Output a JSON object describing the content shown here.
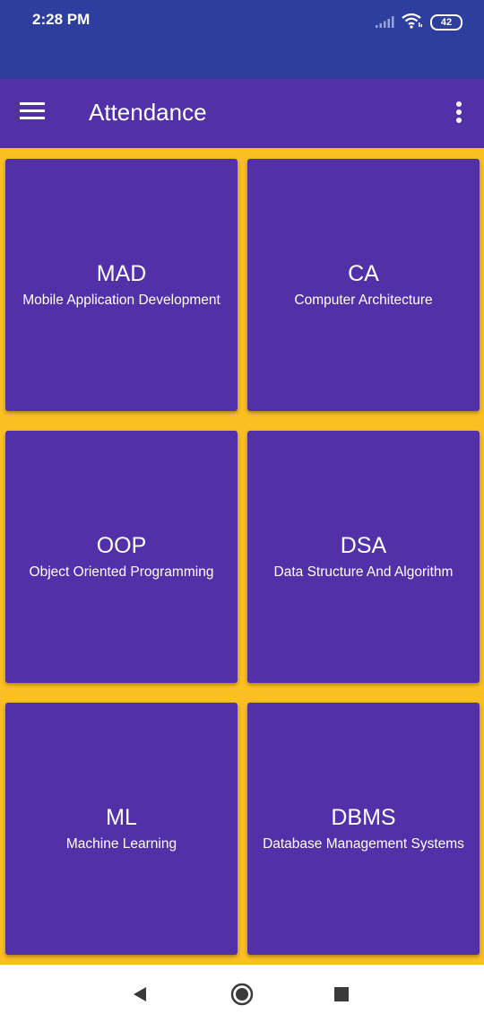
{
  "status_bar": {
    "time": "2:28 PM",
    "battery": "42",
    "icons": [
      "signal-icon",
      "wifi-icon",
      "battery-icon"
    ]
  },
  "app_bar": {
    "title": "Attendance",
    "menu_icon": "hamburger-menu-icon",
    "overflow_icon": "more-vert-icon"
  },
  "courses": [
    {
      "code": "MAD",
      "name": "Mobile Application Development"
    },
    {
      "code": "CA",
      "name": "Computer Architecture"
    },
    {
      "code": "OOP",
      "name": "Object Oriented Programming"
    },
    {
      "code": "DSA",
      "name": "Data Structure And Algorithm"
    },
    {
      "code": "ML",
      "name": "Machine Learning"
    },
    {
      "code": "DBMS",
      "name": "Database Management Systems"
    }
  ],
  "nav_bar": {
    "icons": [
      "back-icon",
      "home-icon",
      "recents-icon"
    ]
  },
  "colors": {
    "status_bar": "#2E3E9E",
    "app_bar": "#5230A8",
    "card": "#5230A8",
    "background": "#FBBF24"
  }
}
